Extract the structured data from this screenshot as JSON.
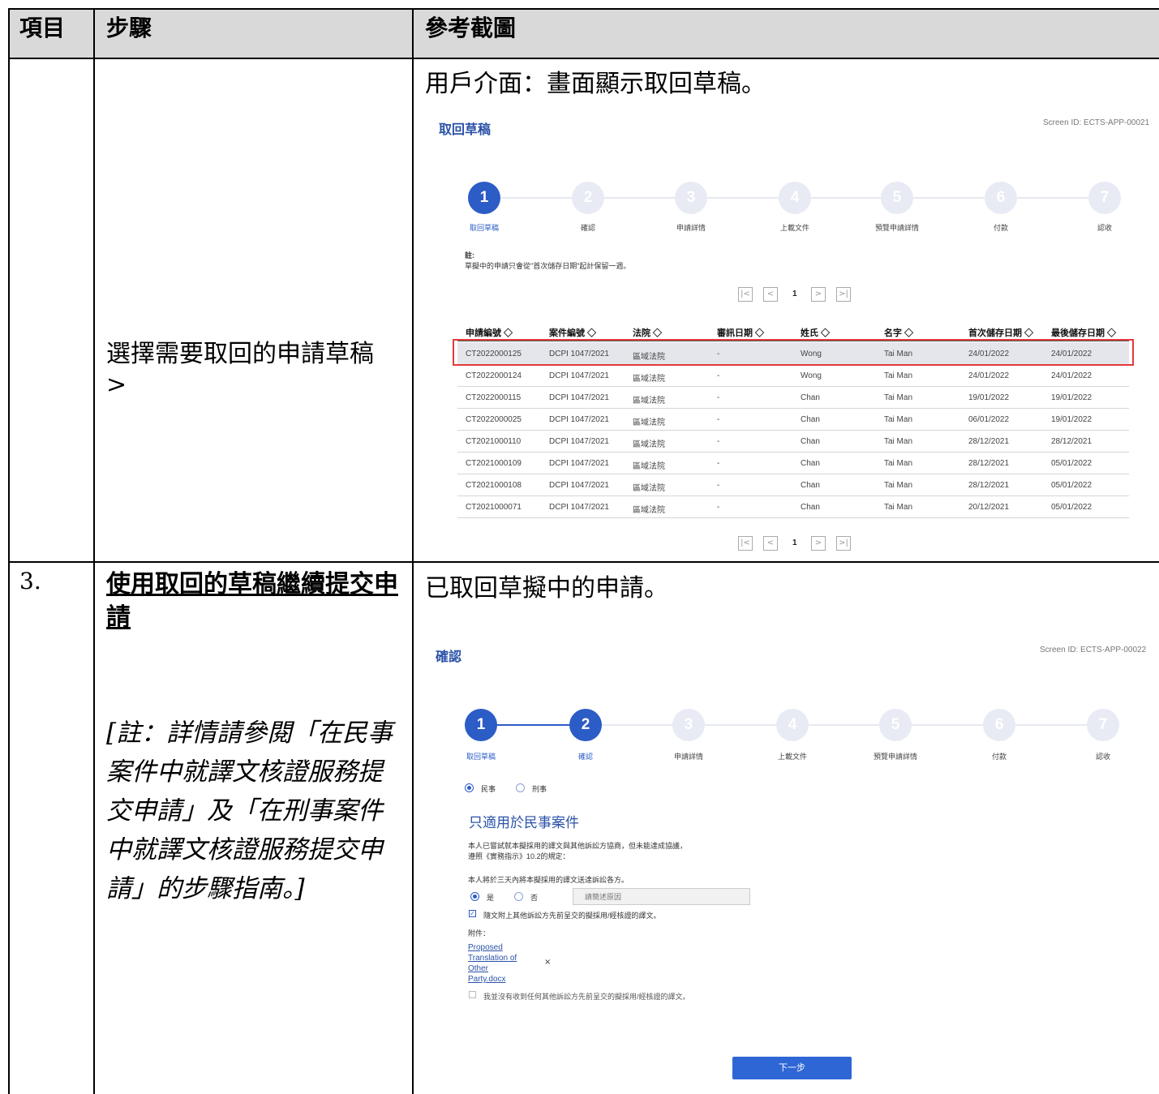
{
  "header": {
    "col1": "項目",
    "col2": "步驟",
    "col3": "參考截圖"
  },
  "row1": {
    "step_text": "選擇需要取回的申請草稿 >",
    "caption": "用戶介面：畫面顯示取回草稿。",
    "screen": {
      "title": "取回草稿",
      "screen_id": "Screen ID: ECTS-APP-00021",
      "steps": [
        "取回草稿",
        "確認",
        "申請詳情",
        "上載文件",
        "預覽申請詳情",
        "付款",
        "認收"
      ],
      "note_title": "註:",
      "note_text": "草擬中的申請只會從\"首次儲存日期\"起計保留一週。",
      "page_number": "1",
      "columns": [
        "申請編號 ◇",
        "案件編號 ◇",
        "法院 ◇",
        "審訊日期 ◇",
        "姓氏 ◇",
        "名字 ◇",
        "首次儲存日期 ◇",
        "最後儲存日期 ◇"
      ],
      "rows": [
        [
          "CT2022000125",
          "DCPI 1047/2021",
          "區域法院",
          "-",
          "Wong",
          "Tai Man",
          "24/01/2022",
          "24/01/2022"
        ],
        [
          "CT2022000124",
          "DCPI 1047/2021",
          "區域法院",
          "-",
          "Wong",
          "Tai Man",
          "24/01/2022",
          "24/01/2022"
        ],
        [
          "CT2022000115",
          "DCPI 1047/2021",
          "區域法院",
          "-",
          "Chan",
          "Tai Man",
          "19/01/2022",
          "19/01/2022"
        ],
        [
          "CT2022000025",
          "DCPI 1047/2021",
          "區域法院",
          "-",
          "Chan",
          "Tai Man",
          "06/01/2022",
          "19/01/2022"
        ],
        [
          "CT2021000110",
          "DCPI 1047/2021",
          "區域法院",
          "-",
          "Chan",
          "Tai Man",
          "28/12/2021",
          "28/12/2021"
        ],
        [
          "CT2021000109",
          "DCPI 1047/2021",
          "區域法院",
          "-",
          "Chan",
          "Tai Man",
          "28/12/2021",
          "05/01/2022"
        ],
        [
          "CT2021000108",
          "DCPI 1047/2021",
          "區域法院",
          "-",
          "Chan",
          "Tai Man",
          "28/12/2021",
          "05/01/2022"
        ],
        [
          "CT2021000071",
          "DCPI 1047/2021",
          "區域法院",
          "-",
          "Chan",
          "Tai Man",
          "20/12/2021",
          "05/01/2022"
        ]
      ]
    }
  },
  "row2": {
    "item": "3.",
    "step_title": "使用取回的草稿繼續提交申請",
    "note": "[註：詳情請參閱「在民事案件中就譯文核證服務提交申請」及「在刑事案件中就譯文核證服務提交申請」的步驟指南。]",
    "caption": "已取回草擬中的申請。",
    "screen": {
      "title": "確認",
      "screen_id": "Screen ID: ECTS-APP-00022",
      "steps": [
        "取回草稿",
        "確認",
        "申請詳情",
        "上載文件",
        "預覽申請詳情",
        "付款",
        "認收"
      ],
      "radio_civil": "民事",
      "radio_criminal": "刑事",
      "section_title": "只適用於民事案件",
      "para1_line1": "本人已嘗試就本擬採用的譯文與其他訴訟方協商，但未能達成協議，",
      "para1_line2": "遵照《實務指示》10.2的規定：",
      "para2": "本人將於三天內將本擬採用的譯文送達訴訟各方。",
      "radio_yes": "是",
      "radio_no": "否",
      "reason_placeholder": "請簡述原因",
      "check1": "隨文附上其他訴訟方先前呈交的擬採用/經核證的譯文。",
      "attachment_label": "附件：",
      "attachment_link": [
        "Proposed",
        "Translation of",
        "Other",
        "Party.docx"
      ],
      "remove_icon": "×",
      "check2": "我並沒有收到任何其他訴訟方先前呈交的擬採用/經核證的譯文。",
      "next_button": "下一步"
    }
  },
  "colors": {
    "accent": "#2c5cc6",
    "highlight": "#e5393a",
    "header_bg": "#d9d9d9"
  }
}
